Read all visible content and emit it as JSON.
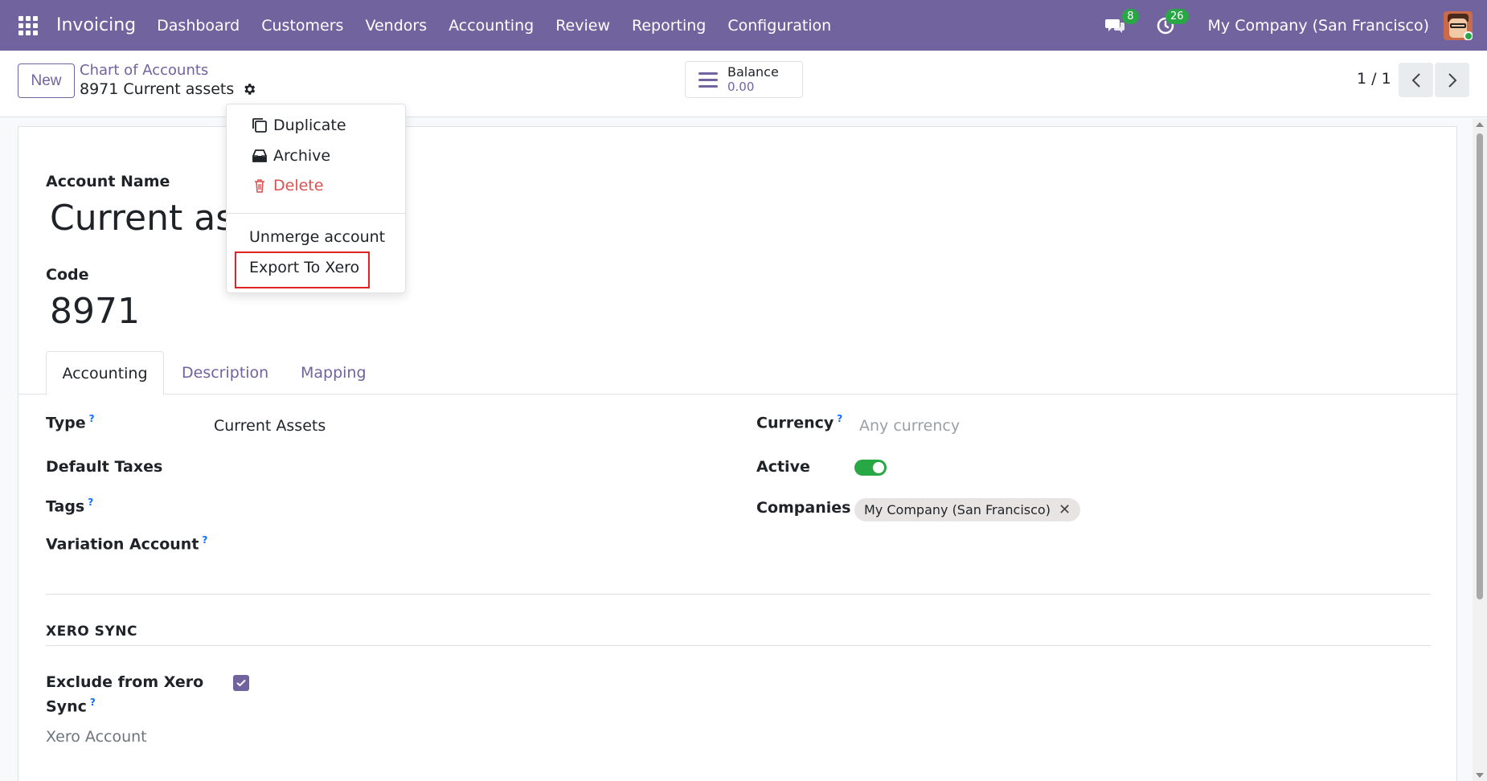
{
  "navbar": {
    "app_name": "Invoicing",
    "menu": [
      "Dashboard",
      "Customers",
      "Vendors",
      "Accounting",
      "Review",
      "Reporting",
      "Configuration"
    ],
    "messages_count": "8",
    "activities_count": "26",
    "company": "My Company (San Francisco)"
  },
  "control": {
    "new_label": "New",
    "breadcrumb_parent": "Chart of Accounts",
    "breadcrumb_current": "8971 Current assets",
    "balance_label": "Balance",
    "balance_value": "0.00",
    "pager": "1 / 1"
  },
  "dropdown": {
    "duplicate": "Duplicate",
    "archive": "Archive",
    "delete": "Delete",
    "unmerge": "Unmerge account",
    "export": "Export To Xero"
  },
  "form": {
    "account_name_label": "Account Name",
    "account_name_value": "Current ass",
    "code_label": "Code",
    "code_value": "8971",
    "tabs": [
      "Accounting",
      "Description",
      "Mapping"
    ],
    "type_label": "Type",
    "type_value": "Current Assets",
    "default_taxes_label": "Default Taxes",
    "tags_label": "Tags",
    "variation_account_label": "Variation Account",
    "currency_label": "Currency",
    "currency_placeholder": "Any currency",
    "active_label": "Active",
    "active": true,
    "companies_label": "Companies",
    "companies_tag": "My Company (San Francisco)",
    "xero_section": "XERO SYNC",
    "exclude_label_line1": "Exclude from Xero",
    "exclude_label_line2": "Sync",
    "exclude_checked": true,
    "xero_account_label": "Xero Account",
    "help_mark": "?"
  },
  "colors": {
    "brand": "#71639e",
    "success": "#28a745",
    "danger": "#d9534f",
    "highlight": "#e02424"
  }
}
